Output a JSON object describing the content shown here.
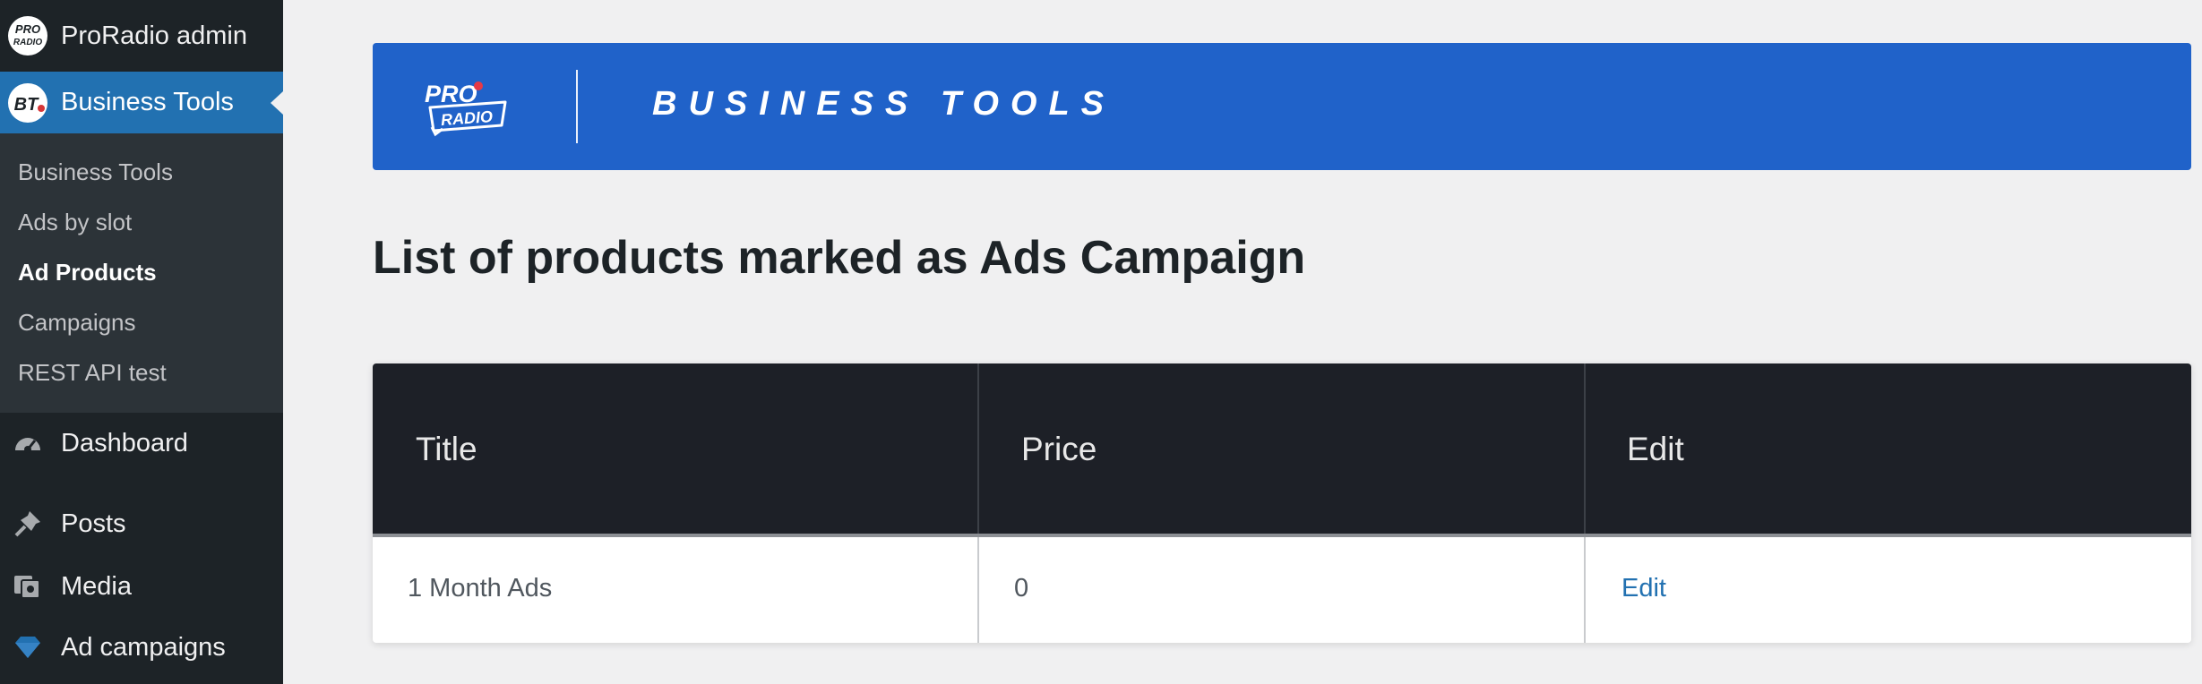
{
  "sidebar": {
    "site_name": "ProRadio admin",
    "current_menu": "Business Tools",
    "submenu": [
      {
        "label": "Business Tools",
        "current": false
      },
      {
        "label": "Ads by slot",
        "current": false
      },
      {
        "label": "Ad Products",
        "current": true
      },
      {
        "label": "Campaigns",
        "current": false
      },
      {
        "label": "REST API test",
        "current": false
      }
    ],
    "menu": [
      {
        "label": "Dashboard",
        "icon": "dashboard-icon"
      },
      {
        "label": "Posts",
        "icon": "pin-icon"
      },
      {
        "label": "Media",
        "icon": "media-icon"
      },
      {
        "label": "Ad campaigns",
        "icon": "diamond-icon"
      }
    ]
  },
  "banner": {
    "logo_text_top": "PRO",
    "logo_text_bottom": "RADIO",
    "title": "BUSINESS TOOLS"
  },
  "page": {
    "heading": "List of products marked as Ads Campaign"
  },
  "table": {
    "headers": [
      "Title",
      "Price",
      "Edit"
    ],
    "rows": [
      {
        "title": "1 Month Ads",
        "price": "0",
        "edit": "Edit"
      }
    ]
  },
  "colors": {
    "sidebar_bg": "#1d2327",
    "accent": "#2271b1",
    "banner_bg": "#2062c9",
    "table_header_bg": "#1d2027"
  }
}
